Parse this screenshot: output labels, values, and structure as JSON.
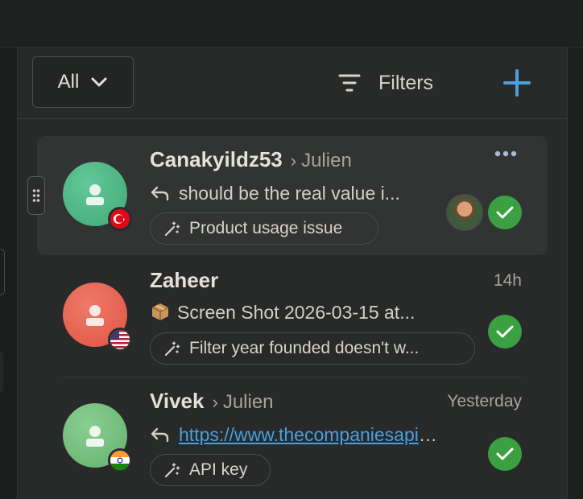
{
  "toolbar": {
    "filter_select_value": "All",
    "filters_label": "Filters"
  },
  "colors": {
    "accent": "#4a9fe0",
    "check_green": "#3aa042",
    "panel_bg": "#282929"
  },
  "conversations": [
    {
      "name": "Canakyildz53",
      "assignee": "Julien",
      "time": "",
      "preview_prefix_icon": "reply-icon",
      "preview": "should be the real value i...",
      "tag": "Product usage issue",
      "flag": "turkey-flag",
      "avatar_color": "#48b07e",
      "selected": true
    },
    {
      "name": "Zaheer",
      "assignee": "",
      "time": "14h",
      "preview_prefix_icon": "package-emoji",
      "preview": "Screen Shot 2026-03-15 at...",
      "tag": "Filter year founded doesn't w...",
      "flag": "usa-flag",
      "avatar_color": "#e05a4a",
      "selected": false
    },
    {
      "name": "Vivek",
      "assignee": "Julien",
      "time": "Yesterday",
      "preview_prefix_icon": "reply-icon",
      "preview": "https://www.thecompaniesapi.com",
      "tag": "API key",
      "flag": "india-flag",
      "avatar_color": "#6fb878",
      "selected": false
    }
  ]
}
